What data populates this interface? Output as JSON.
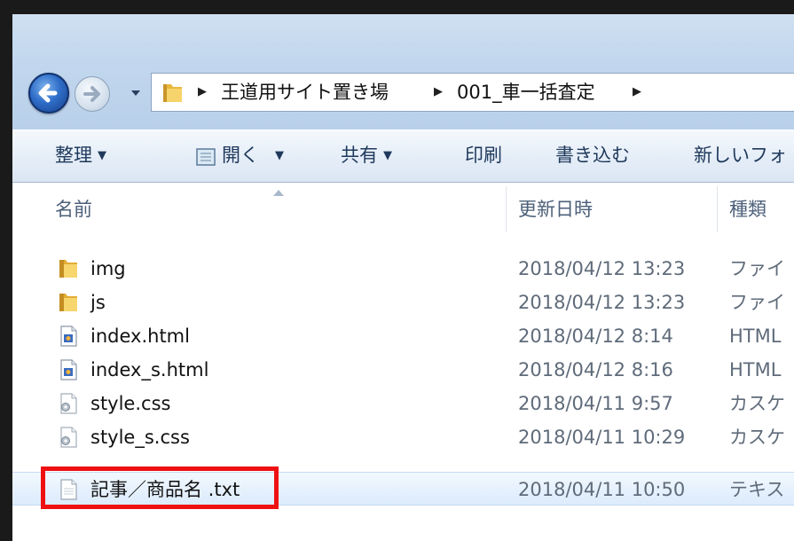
{
  "address": {
    "crumbs": [
      "王道用サイト置き場",
      "001_車一括査定"
    ]
  },
  "toolbar": {
    "organize_label": "整理",
    "open_label": "開く",
    "share_label": "共有",
    "print_label": "印刷",
    "burn_label": "書き込む",
    "new_folder_label": "新しいフォ"
  },
  "columns": {
    "name": "名前",
    "modified": "更新日時",
    "type": "種類"
  },
  "files": [
    {
      "name": "img",
      "date": "2018/04/12 13:23",
      "type": "ファイ",
      "icon": "folder-icon"
    },
    {
      "name": "js",
      "date": "2018/04/12 13:23",
      "type": "ファイ",
      "icon": "folder-icon"
    },
    {
      "name": "index.html",
      "date": "2018/04/12 8:14",
      "type": "HTML",
      "icon": "html-file-icon"
    },
    {
      "name": "index_s.html",
      "date": "2018/04/12 8:16",
      "type": "HTML",
      "icon": "html-file-icon"
    },
    {
      "name": "style.css",
      "date": "2018/04/11 9:57",
      "type": "カスケ",
      "icon": "css-file-icon"
    },
    {
      "name": "style_s.css",
      "date": "2018/04/11 10:29",
      "type": "カスケ",
      "icon": "css-file-icon"
    },
    {
      "name": "記事／商品名 .txt",
      "date": "2018/04/11 10:50",
      "type": "テキス",
      "icon": "text-file-icon"
    }
  ],
  "selected_index": 6,
  "colors": {
    "highlight": "#ee1111",
    "toolbar_text": "#1e395b",
    "glass": "#c2d7ee"
  }
}
